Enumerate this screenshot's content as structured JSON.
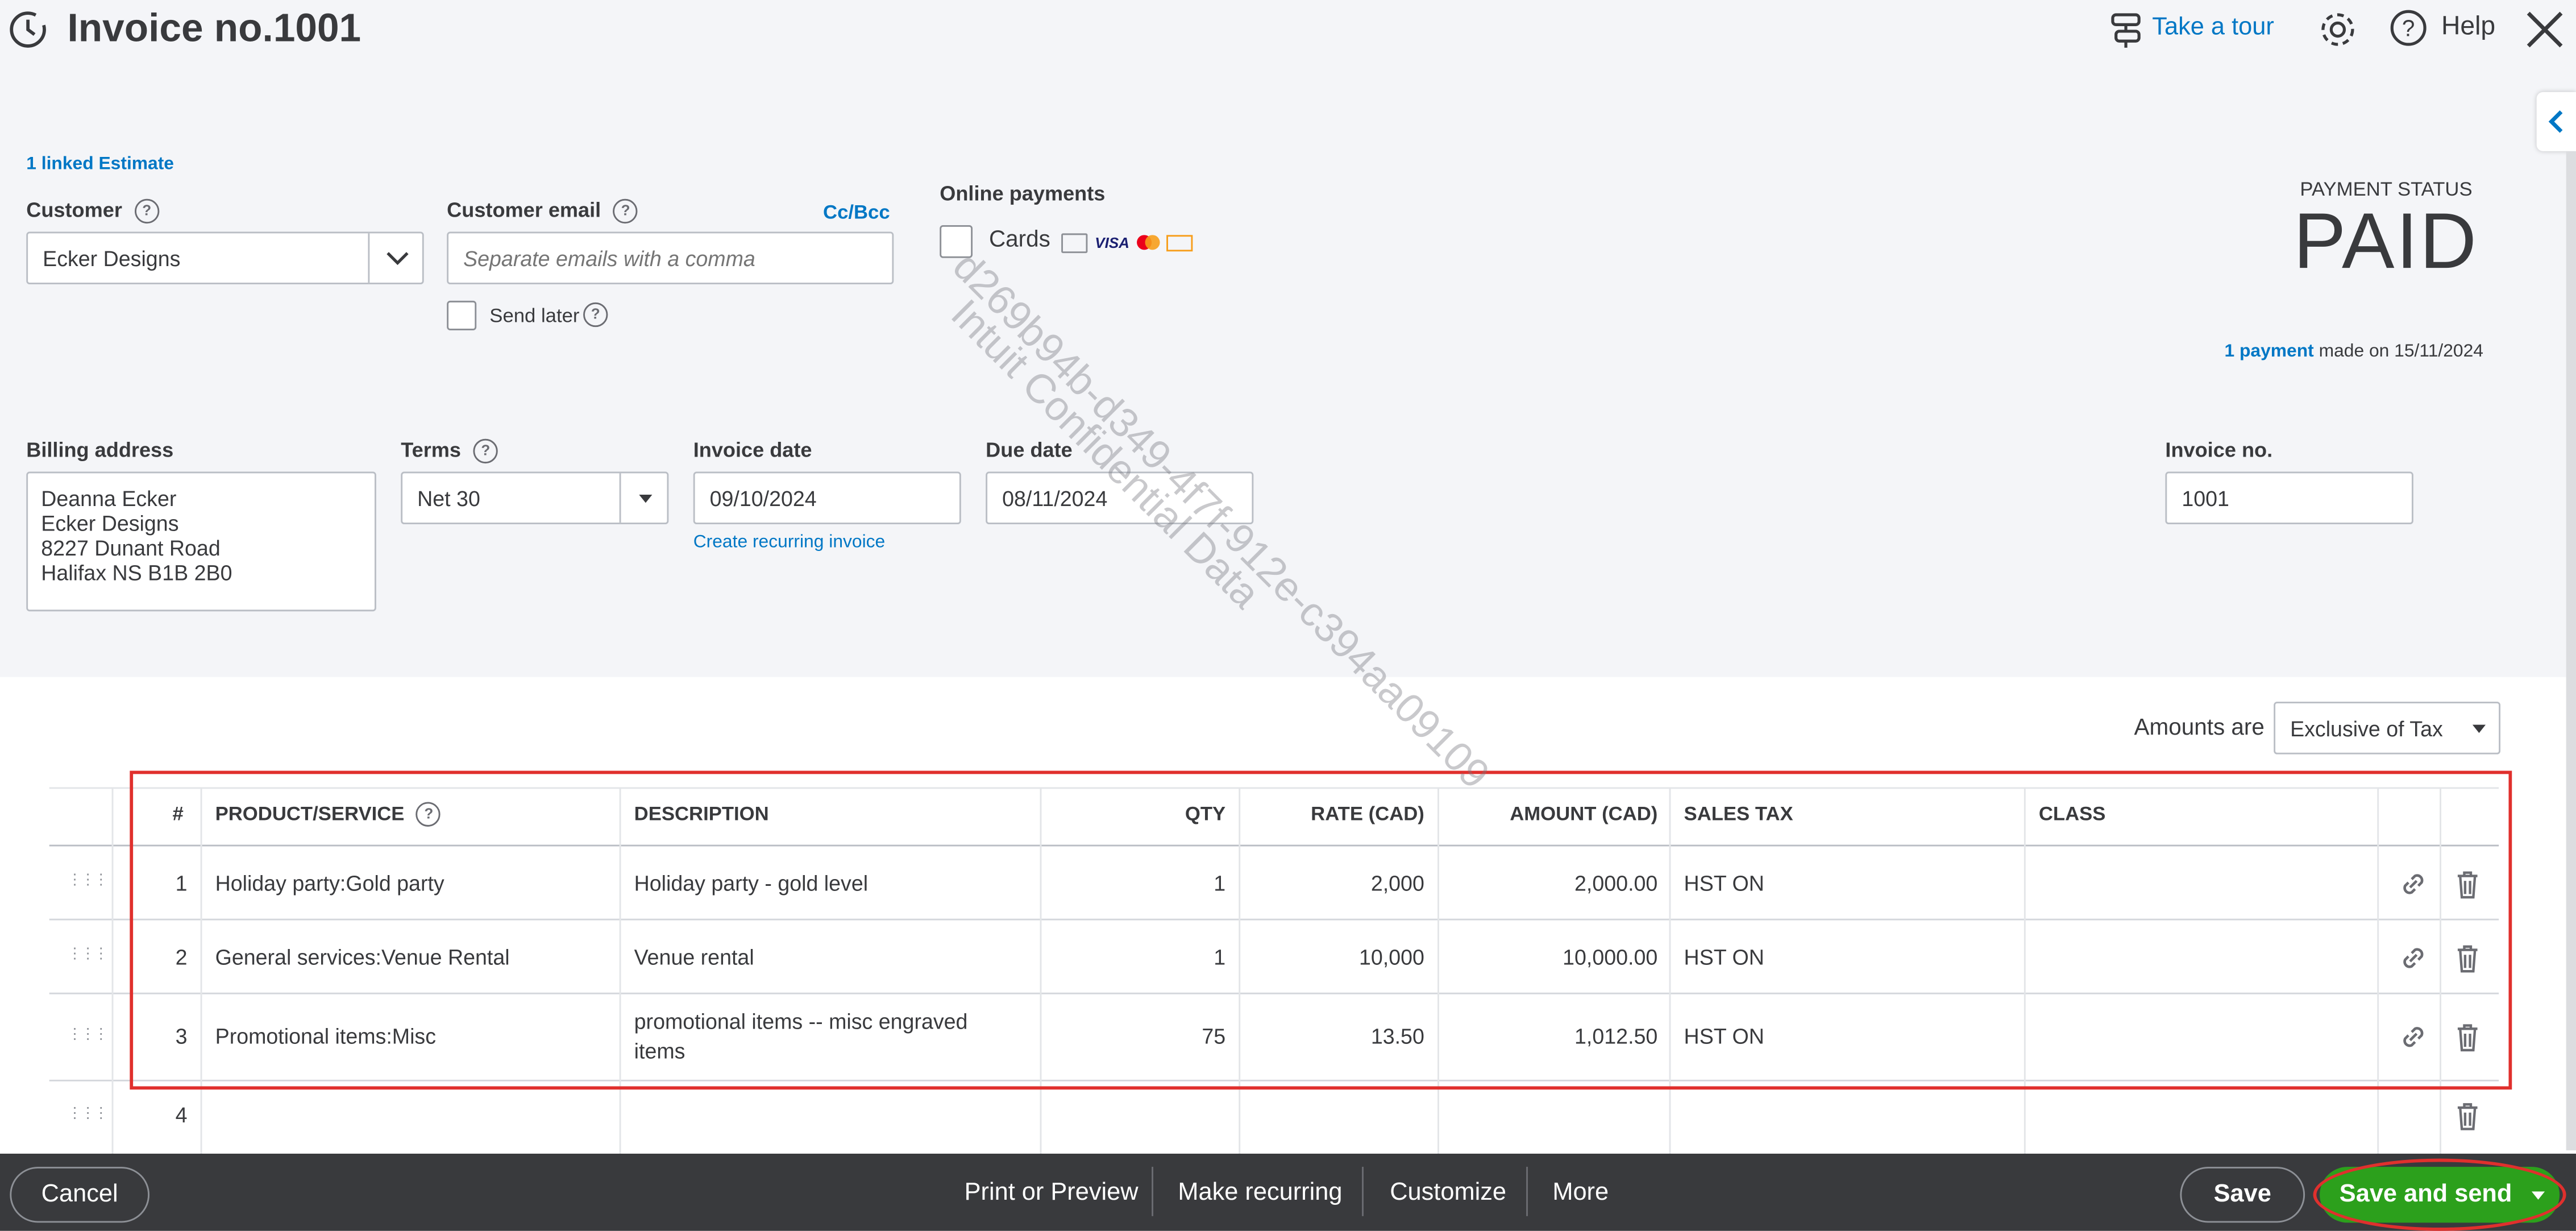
{
  "header": {
    "title": "Invoice no.1001",
    "take_tour": "Take a tour",
    "help": "Help"
  },
  "linked_estimate": "1 linked Estimate",
  "customer": {
    "label": "Customer",
    "value": "Ecker Designs"
  },
  "customer_email": {
    "label": "Customer email",
    "placeholder": "Separate emails with a comma",
    "cc_bcc": "Cc/Bcc",
    "send_later": "Send later"
  },
  "online_payments": {
    "label": "Online payments",
    "cards": "Cards",
    "card_brands": [
      "VISA"
    ]
  },
  "payment_status": {
    "label": "PAYMENT STATUS",
    "value": "PAID",
    "payment_link": "1 payment",
    "made_on": "made on 15/11/2024"
  },
  "billing": {
    "label": "Billing address",
    "lines": [
      "Deanna Ecker",
      "Ecker Designs",
      "8227 Dunant Road",
      "Halifax NS  B1B 2B0"
    ]
  },
  "terms": {
    "label": "Terms",
    "value": "Net 30"
  },
  "invoice_date": {
    "label": "Invoice date",
    "value": "09/10/2024",
    "recurring_link": "Create recurring invoice"
  },
  "due_date": {
    "label": "Due date",
    "value": "08/11/2024"
  },
  "invoice_no": {
    "label": "Invoice no.",
    "value": "1001"
  },
  "watermark": {
    "line1": "d269b94b-d349-4f7f-912e-c394aa09109",
    "line2": "Intuit Confidential Data"
  },
  "amounts_are": {
    "label": "Amounts are",
    "value": "Exclusive of Tax"
  },
  "table": {
    "headers": {
      "num": "#",
      "product": "PRODUCT/SERVICE",
      "description": "DESCRIPTION",
      "qty": "QTY",
      "rate": "RATE (CAD)",
      "amount": "AMOUNT (CAD)",
      "tax": "SALES TAX",
      "class": "CLASS"
    },
    "rows": [
      {
        "num": "1",
        "product": "Holiday party:Gold party",
        "description": "Holiday party - gold level",
        "description2": "",
        "qty": "1",
        "rate": "2,000",
        "amount": "2,000.00",
        "tax": "HST ON",
        "class": ""
      },
      {
        "num": "2",
        "product": "General services:Venue Rental",
        "description": "Venue rental",
        "description2": "",
        "qty": "1",
        "rate": "10,000",
        "amount": "10,000.00",
        "tax": "HST ON",
        "class": ""
      },
      {
        "num": "3",
        "product": "Promotional items:Misc",
        "description": "promotional items -- misc engraved",
        "description2": "items",
        "qty": "75",
        "rate": "13.50",
        "amount": "1,012.50",
        "tax": "HST ON",
        "class": ""
      },
      {
        "num": "4",
        "product": "",
        "description": "",
        "description2": "",
        "qty": "",
        "rate": "",
        "amount": "",
        "tax": "",
        "class": ""
      }
    ]
  },
  "footer": {
    "cancel": "Cancel",
    "print_preview": "Print or Preview",
    "make_recurring": "Make recurring",
    "customize": "Customize",
    "more": "More",
    "save": "Save",
    "save_and_send": "Save and send"
  },
  "colors": {
    "accent": "#0077c5",
    "success": "#2ca01c",
    "highlight": "#e0302d",
    "footer": "#393a3d",
    "band": "#f4f5f8"
  },
  "icons": [
    "history-icon",
    "tour-icon",
    "gear-icon",
    "help-icon",
    "close-icon",
    "collapse-panel-icon",
    "chevron-down-icon",
    "drag-grip-icon",
    "link-icon",
    "trash-icon",
    "dropdown-arrow-icon"
  ]
}
